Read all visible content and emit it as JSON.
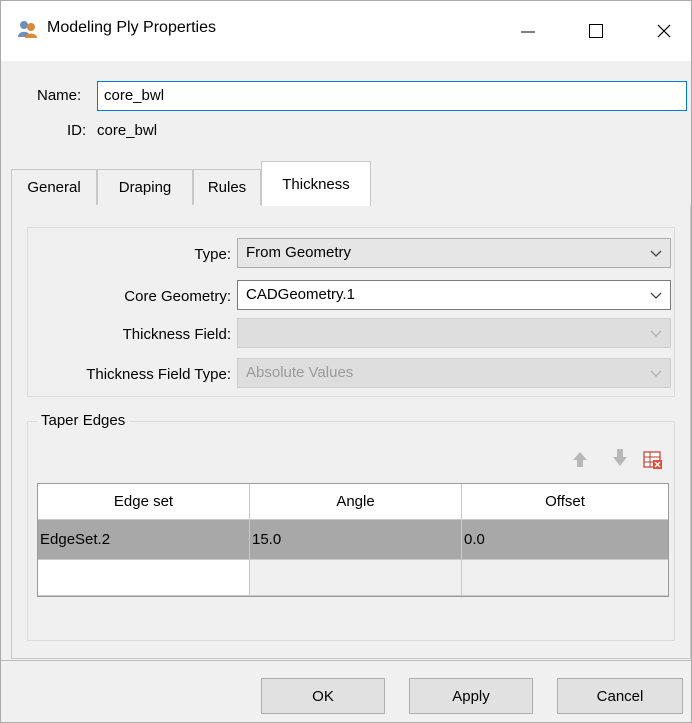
{
  "window": {
    "title": "Modeling Ply Properties",
    "icon": "modeling-ply-icon"
  },
  "header": {
    "name_label": "Name:",
    "name_value": "core_bwl",
    "id_label": "ID:",
    "id_value": "core_bwl"
  },
  "tabs": [
    {
      "label": "General",
      "active": false
    },
    {
      "label": "Draping",
      "active": false
    },
    {
      "label": "Rules",
      "active": false
    },
    {
      "label": "Thickness",
      "active": true
    }
  ],
  "form": {
    "type_label": "Type:",
    "type_value": "From Geometry",
    "core_geometry_label": "Core Geometry:",
    "core_geometry_value": "CADGeometry.1",
    "thickness_field_label": "Thickness Field:",
    "thickness_field_value": "",
    "thickness_field_type_label": "Thickness Field Type:",
    "thickness_field_type_value": "Absolute Values"
  },
  "taper_edges": {
    "group_label": "Taper Edges",
    "toolbar_icons": [
      "move-up-icon",
      "move-down-icon",
      "delete-row-icon"
    ],
    "columns": [
      "Edge set",
      "Angle",
      "Offset"
    ],
    "rows": [
      {
        "edge_set": "EdgeSet.2",
        "angle": "15.0",
        "offset": "0.0",
        "selected": true
      },
      {
        "edge_set": "",
        "angle": "",
        "offset": "",
        "selected": false
      }
    ]
  },
  "buttons": {
    "ok": "OK",
    "apply": "Apply",
    "cancel": "Cancel"
  }
}
